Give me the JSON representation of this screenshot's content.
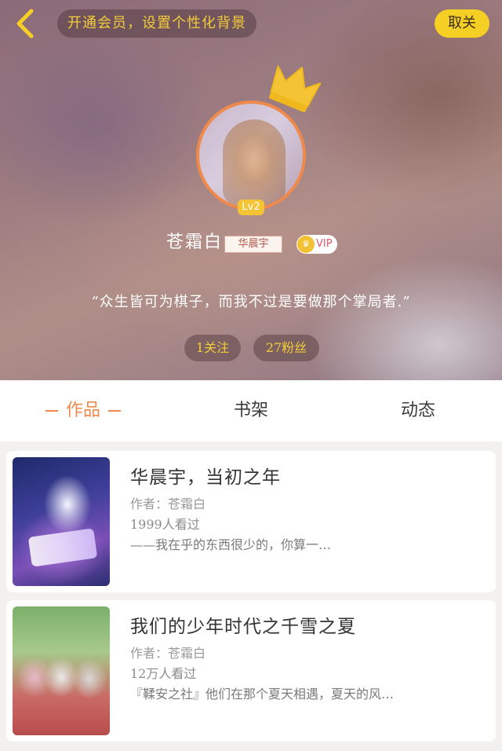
{
  "header": {
    "vip_banner": "开通会员，设置个性化背景",
    "follow_button": "取关",
    "level_badge": "Lv2",
    "username": "苍霜白",
    "fan_tag": "华晨宇",
    "vip_icon_text": "♛",
    "vip_label": "VIP",
    "signature": "“众生皆可为棋子，而我不过是要做那个掌局者.”",
    "following": "1关注",
    "fans": "27粉丝"
  },
  "tabs": [
    {
      "label": "作品",
      "active": true
    },
    {
      "label": "书架",
      "active": false
    },
    {
      "label": "动态",
      "active": false
    }
  ],
  "works": [
    {
      "title": "华晨宇，当初之年",
      "author": "作者：苍霜白",
      "views": "1999人看过",
      "description": "——我在乎的东西很少的，你算一…"
    },
    {
      "title": "我们的少年时代之千雪之夏",
      "author": "作者：苍霜白",
      "views": "12万人看过",
      "description": "『鞣安之社』他们在那个夏天相遇，夏天的风…"
    }
  ],
  "colors": {
    "accent": "#ee8a4e",
    "gold": "#f6cf25",
    "banner_text": "#f2cc3a"
  },
  "icons": {
    "back": "chevron-left-icon",
    "crown": "crown-icon"
  }
}
